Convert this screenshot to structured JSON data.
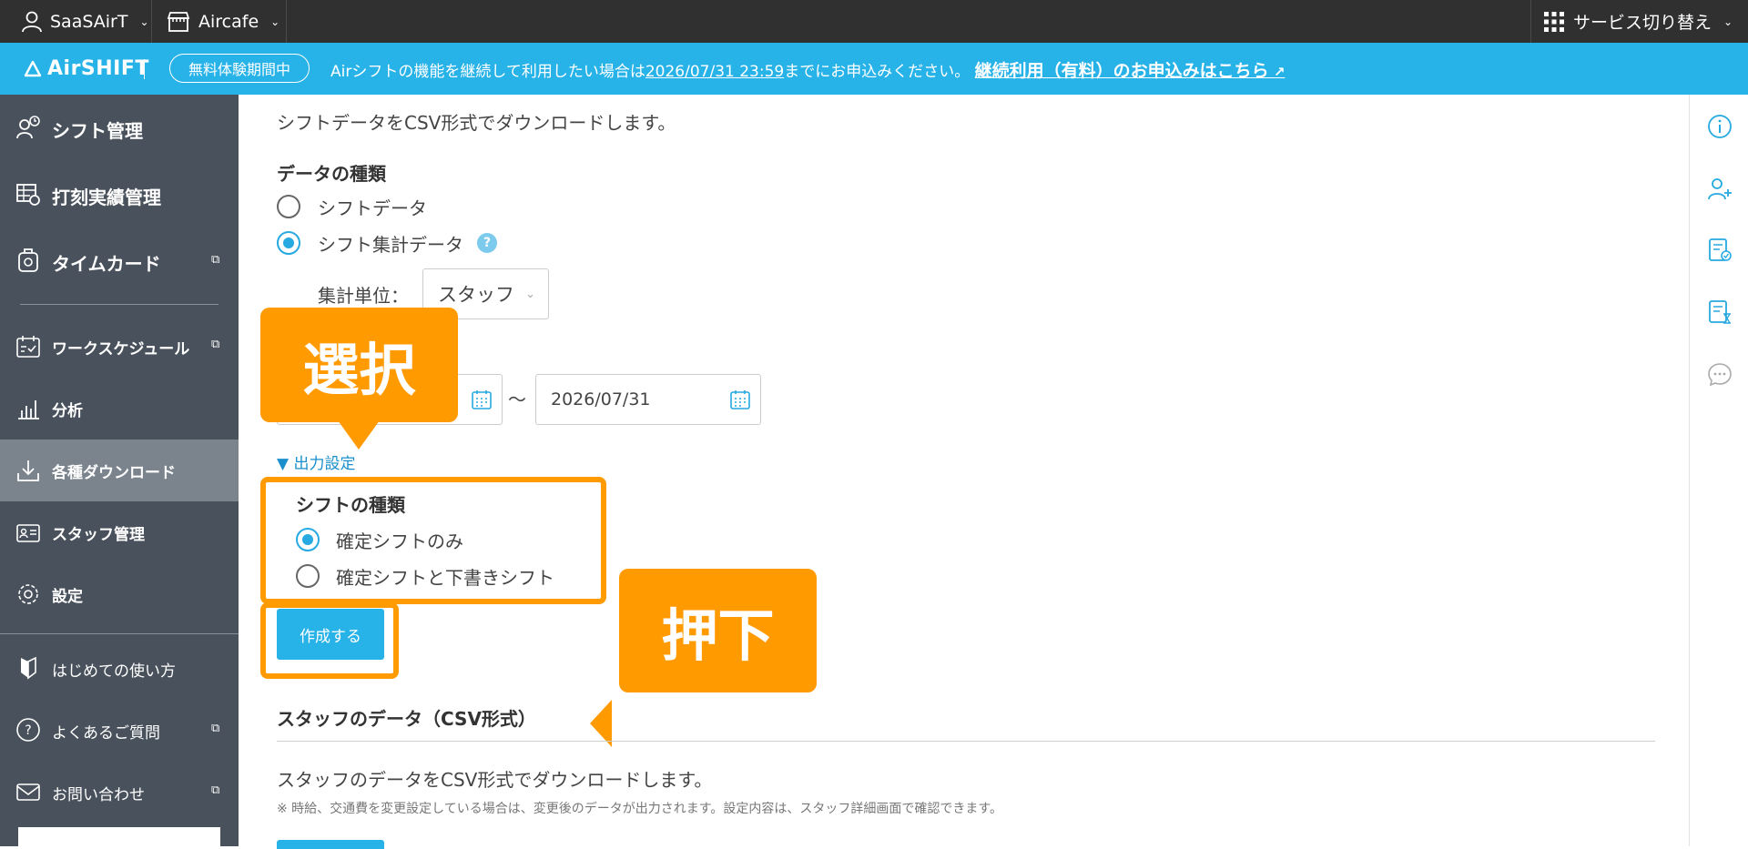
{
  "topbar": {
    "account_label": "SaaSAirT",
    "store_label": "Aircafe",
    "service_switch_label": "サービス切り替え"
  },
  "notice": {
    "logo_text": "AirSHIFT",
    "trial_badge": "無料体験期間中",
    "text_before": "Airシフトの機能を継続して利用したい場合は",
    "deadline": "2026/07/31 23:59",
    "text_after": "までにお申込みください。",
    "link_label": "継続利用（有料）のお申込みはこちら"
  },
  "sidebar": {
    "items": [
      {
        "label": "シフト管理",
        "icon": "shift-icon"
      },
      {
        "label": "打刻実績管理",
        "icon": "timesheet-icon"
      },
      {
        "label": "タイムカード",
        "icon": "timecard-icon"
      },
      {
        "label": "ワークスケジュール",
        "icon": "schedule-icon"
      },
      {
        "label": "分析",
        "icon": "chart-icon"
      },
      {
        "label": "各種ダウンロード",
        "icon": "download-icon"
      },
      {
        "label": "スタッフ管理",
        "icon": "staff-card-icon"
      },
      {
        "label": "設定",
        "icon": "gear-icon"
      },
      {
        "label": "はじめての使い方",
        "icon": "beginner-icon"
      },
      {
        "label": "よくあるご質問",
        "icon": "question-icon"
      },
      {
        "label": "お問い合わせ",
        "icon": "mail-icon"
      }
    ]
  },
  "main": {
    "shift_section_desc": "シフトデータをCSV形式でダウンロードします。",
    "data_type_heading": "データの種類",
    "data_type_options": [
      "シフトデータ",
      "シフト集計データ"
    ],
    "data_type_selected": "シフト集計データ",
    "aggregation_label": "集計単位：",
    "aggregation_value": "スタッフ",
    "end_date": "2026/07/31",
    "date_separator": "〜",
    "output_settings_toggle": "▼ 出力設定",
    "shift_kind_heading": "シフトの種類",
    "shift_kind_options": [
      "確定シフトのみ",
      "確定シフトと下書きシフト"
    ],
    "shift_kind_selected": "確定シフトのみ",
    "create_button": "作成する",
    "staff_section_title": "スタッフのデータ（CSV形式）",
    "staff_section_desc": "スタッフのデータをCSV形式でダウンロードします。",
    "staff_section_note": "※ 時給、交通費を変更設定している場合は、変更後のデータが出力されます。設定内容は、スタッフ詳細画面で確認できます。"
  },
  "annotations": {
    "select_callout": "選択",
    "press_callout": "押下",
    "highlight_color": "#ff9a00"
  },
  "colors": {
    "accent": "#27b2e8",
    "sidebar_bg": "#49525c",
    "topbar_bg": "#303030"
  }
}
